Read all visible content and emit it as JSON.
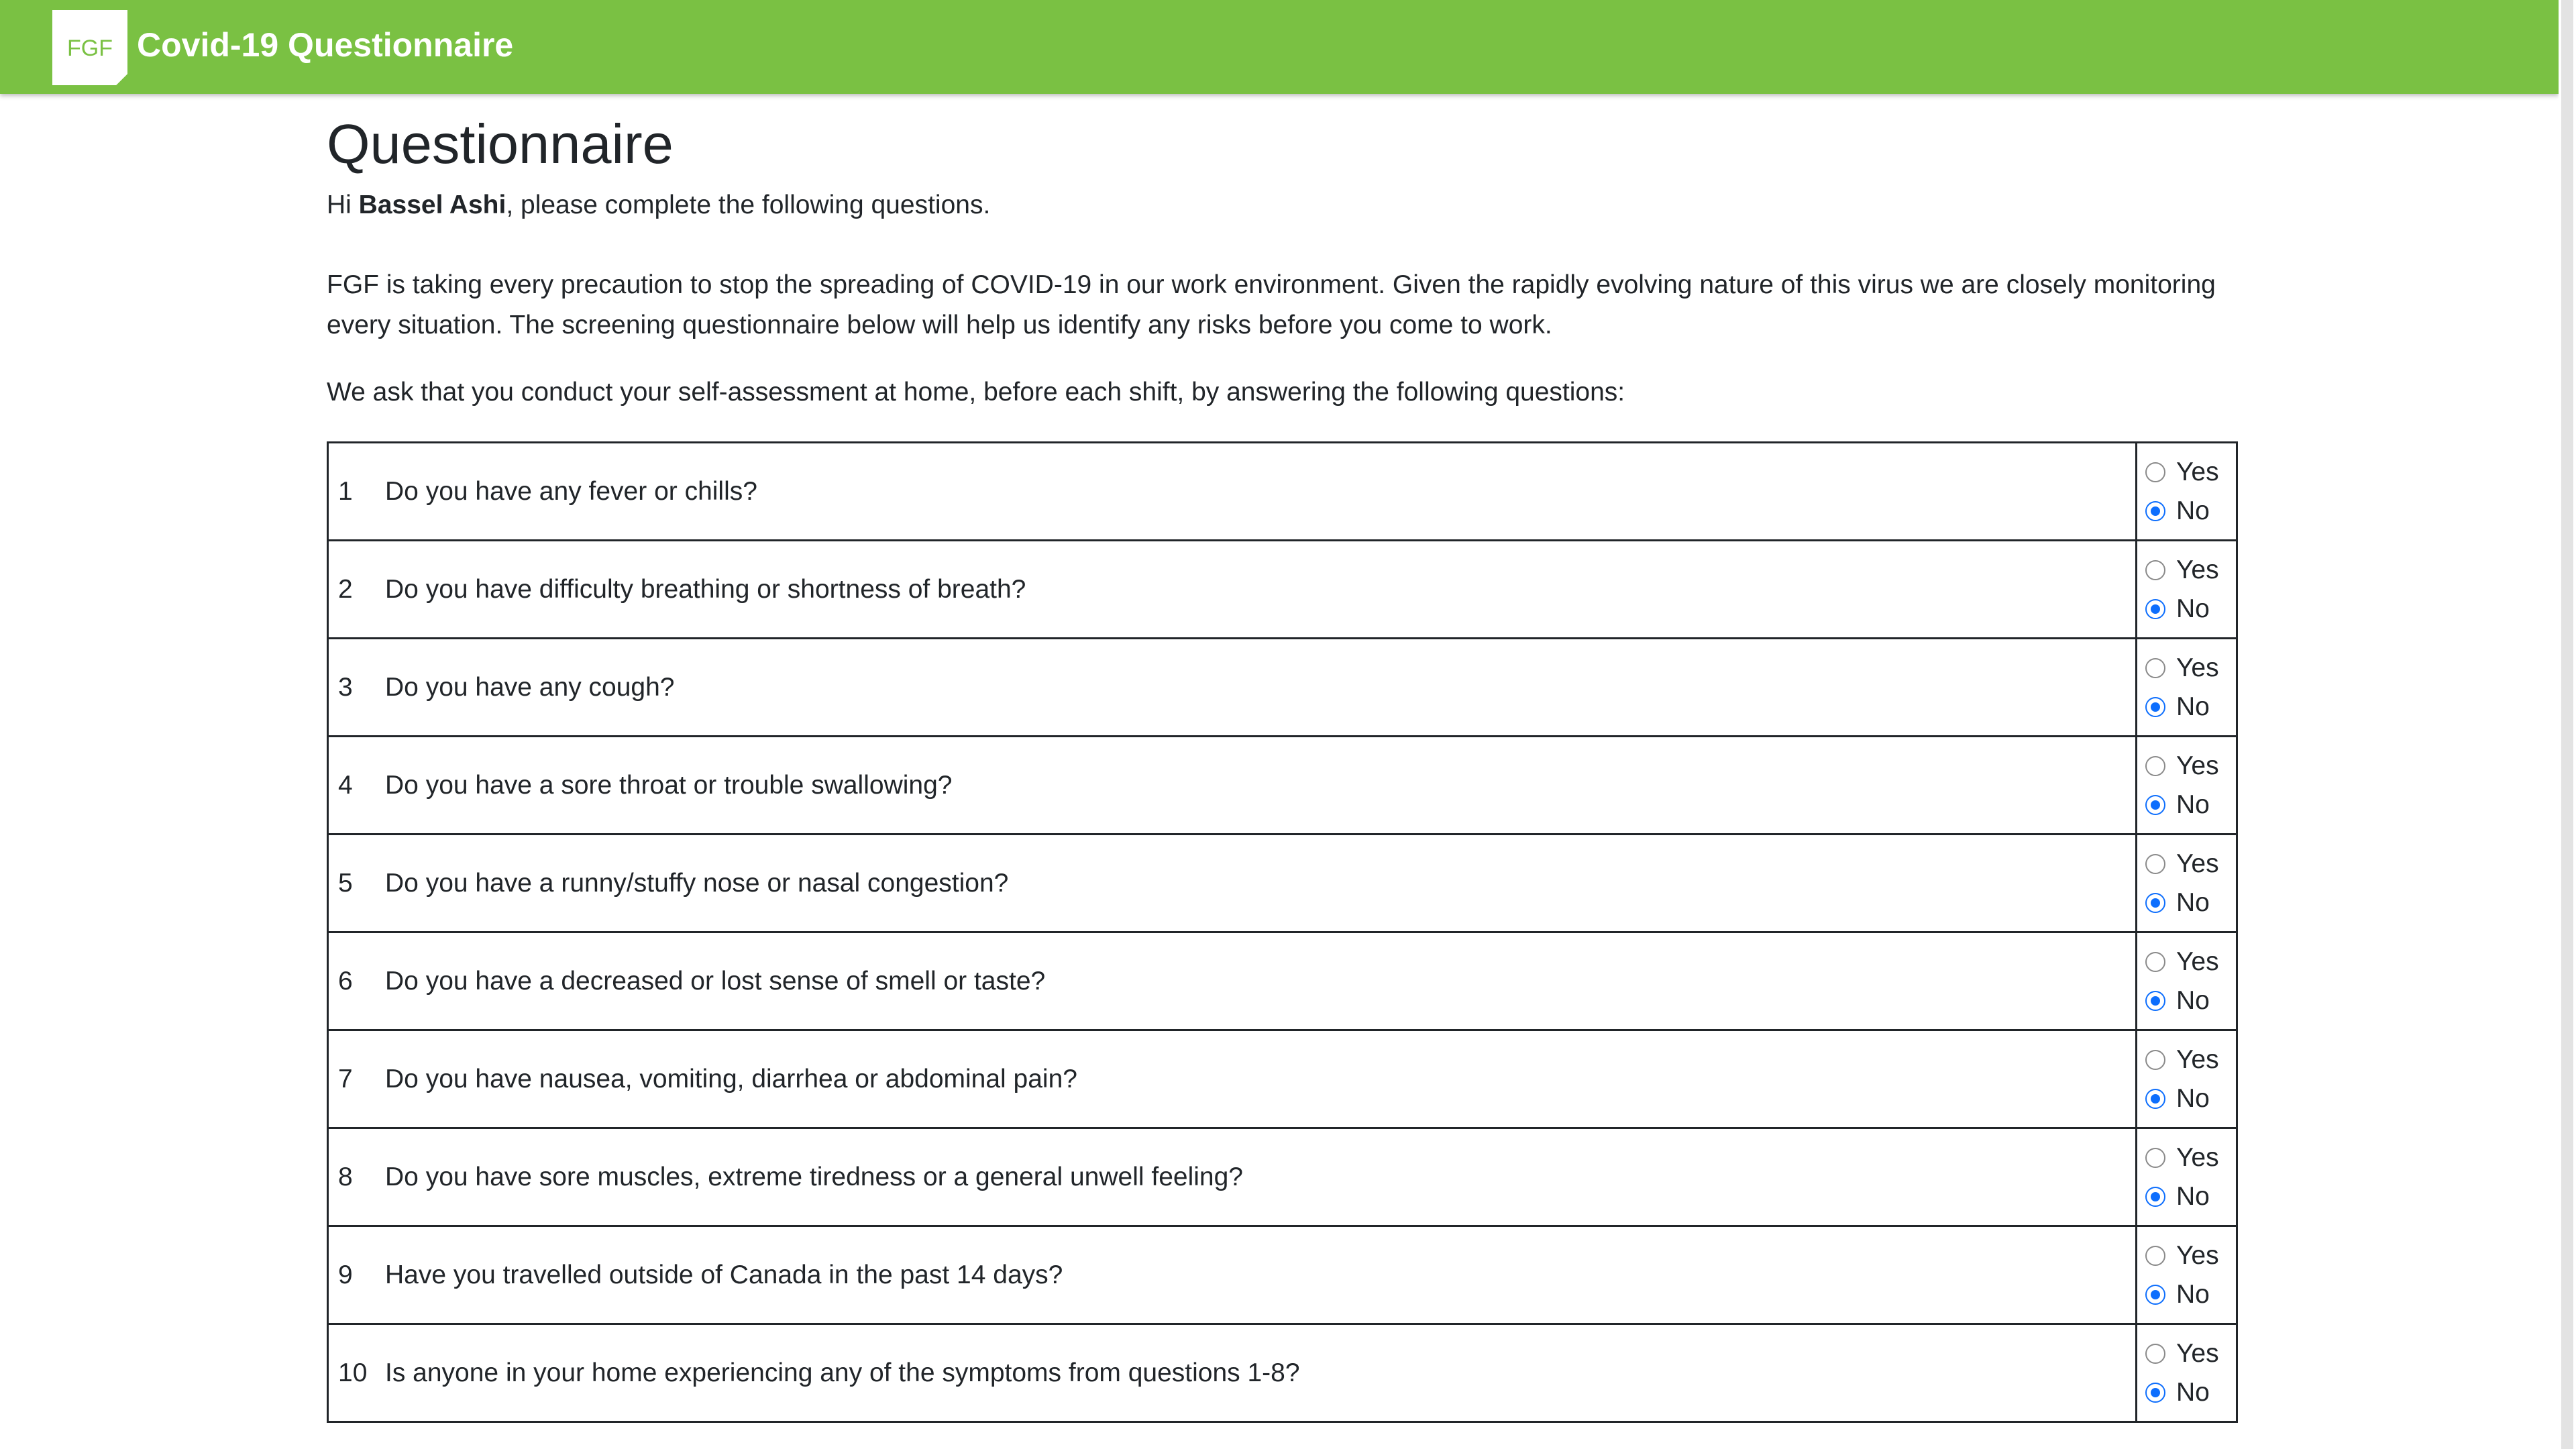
{
  "header": {
    "logo_text": "FGF",
    "title": "Covid-19 Questionnaire",
    "background_color": "#7ac143"
  },
  "page": {
    "title": "Questionnaire",
    "greeting_prefix": "Hi ",
    "user_name": "Bassel Ashi",
    "greeting_suffix": ", please complete the following questions.",
    "intro": "FGF is taking every precaution to stop the spreading of COVID-19 in our work environment. Given the rapidly evolving nature of this virus we are closely monitoring every situation. The screening questionnaire below will help us identify any risks before you come to work.",
    "instruction": "We ask that you conduct your self-assessment at home, before each shift, by answering the following questions:"
  },
  "options": {
    "yes": "Yes",
    "no": "No"
  },
  "questions": [
    {
      "num": "1",
      "text": "Do you have any fever or chills?",
      "selected": "No"
    },
    {
      "num": "2",
      "text": "Do you have difficulty breathing or shortness of breath?",
      "selected": "No"
    },
    {
      "num": "3",
      "text": "Do you have any cough?",
      "selected": "No"
    },
    {
      "num": "4",
      "text": "Do you have a sore throat or trouble swallowing?",
      "selected": "No"
    },
    {
      "num": "5",
      "text": "Do you have a runny/stuffy nose or nasal congestion?",
      "selected": "No"
    },
    {
      "num": "6",
      "text": "Do you have a decreased or lost sense of smell or taste?",
      "selected": "No"
    },
    {
      "num": "7",
      "text": "Do you have nausea, vomiting, diarrhea or abdominal pain?",
      "selected": "No"
    },
    {
      "num": "8",
      "text": "Do you have sore muscles, extreme tiredness or a general unwell feeling?",
      "selected": "No"
    },
    {
      "num": "9",
      "text": "Have you travelled outside of Canada in the past 14 days?",
      "selected": "No"
    },
    {
      "num": "10",
      "text": "Is anyone in your home experiencing any of the symptoms from questions 1-8?",
      "selected": "No"
    }
  ]
}
